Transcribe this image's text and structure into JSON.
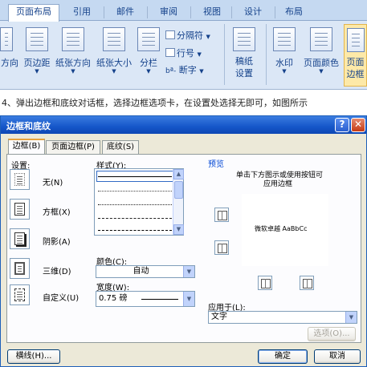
{
  "ribbon": {
    "tabs": [
      "页面布局",
      "引用",
      "邮件",
      "审阅",
      "视图",
      "设计",
      "布局"
    ],
    "buttons": {
      "text_direction": "方向",
      "margins": "页边距",
      "orientation": "纸张方向",
      "size": "纸张大小",
      "columns": "分栏",
      "draft_paper": [
        "稿纸",
        "设置"
      ],
      "watermark": "水印",
      "page_color": "页面颜色",
      "page_border": [
        "页面",
        "边框"
      ]
    },
    "small": {
      "breaks": "分隔符",
      "line_numbers": "行号",
      "hyphenation": "断字",
      "hyph_prefix": "bª-"
    }
  },
  "instruction": "4、弹出边框和底纹对话框，选择边框选项卡，在设置处选择无即可，如图所示",
  "dialog": {
    "title": "边框和底纹",
    "tabs": [
      "边框(B)",
      "页面边框(P)",
      "底纹(S)"
    ],
    "setting": {
      "label": "设置:",
      "options": [
        "无(N)",
        "方框(X)",
        "阴影(A)",
        "三维(D)",
        "自定义(U)"
      ]
    },
    "style": {
      "label": "样式(Y):"
    },
    "color": {
      "label": "颜色(C):",
      "value": "自动"
    },
    "width": {
      "label": "宽度(W):",
      "value": "0.75 磅"
    },
    "preview": {
      "label": "预览",
      "hint": [
        "单击下方图示或使用按钮可",
        "应用边框"
      ],
      "sample_text": "微软卓越  AaBbCc"
    },
    "apply_to": {
      "label": "应用于(L):",
      "value": "文字"
    },
    "buttons": {
      "options": "选项(O)...",
      "horizontal_line": "横线(H)...",
      "ok": "确定",
      "cancel": "取消"
    }
  }
}
